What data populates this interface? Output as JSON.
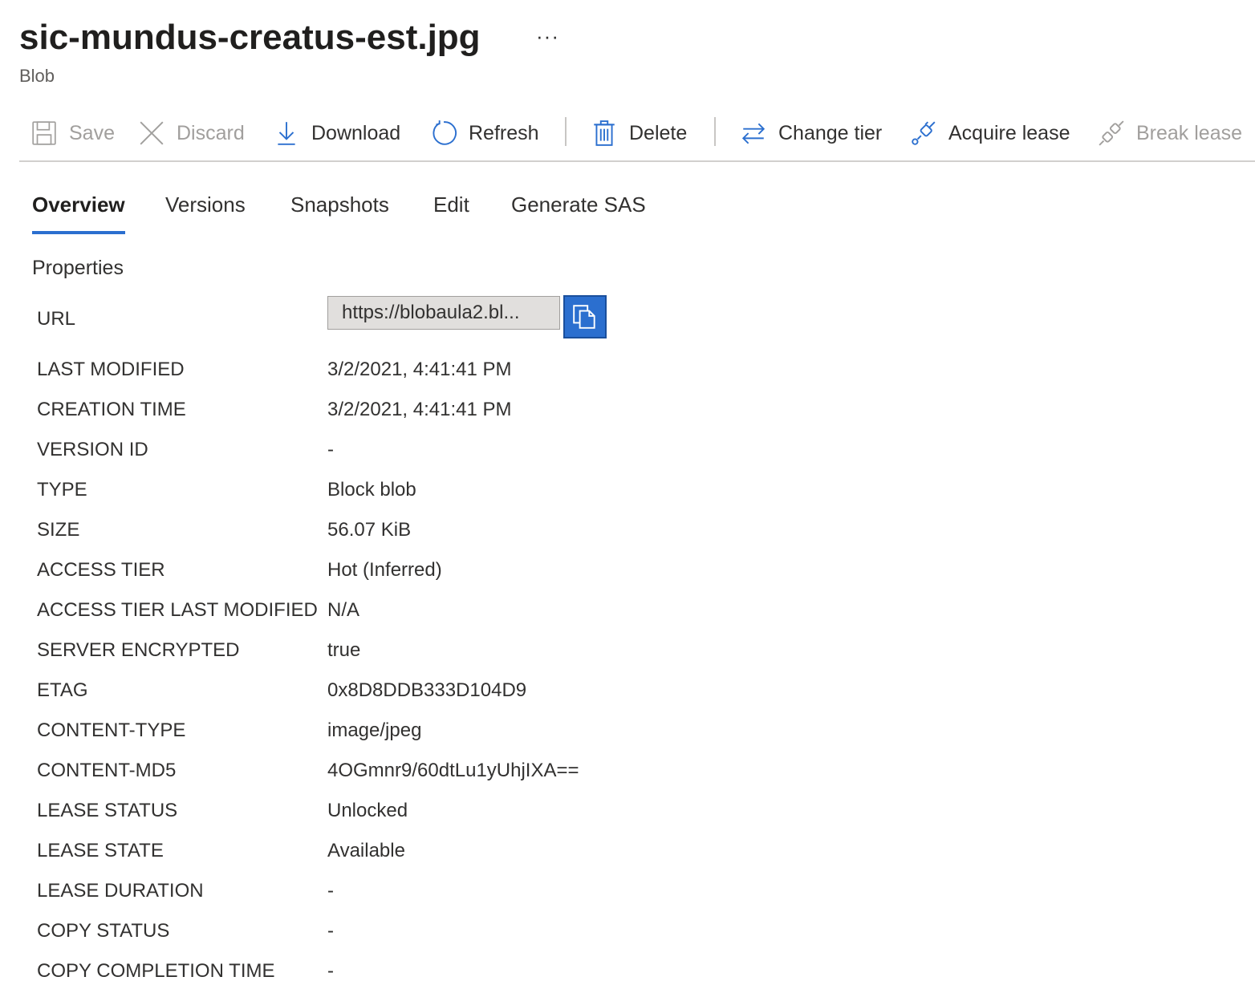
{
  "header": {
    "title": "sic-mundus-creatus-est.jpg",
    "subtitle": "Blob",
    "more_label": "···"
  },
  "toolbar": {
    "save": "Save",
    "discard": "Discard",
    "download": "Download",
    "refresh": "Refresh",
    "delete": "Delete",
    "change_tier": "Change tier",
    "acquire_lease": "Acquire lease",
    "break_lease": "Break lease"
  },
  "tabs": {
    "overview": "Overview",
    "versions": "Versions",
    "snapshots": "Snapshots",
    "edit": "Edit",
    "generate_sas": "Generate SAS",
    "active": "Overview"
  },
  "properties": {
    "heading": "Properties",
    "url_label": "URL",
    "url_value": "https://blobaula2.bl...",
    "rows": [
      {
        "label": "LAST MODIFIED",
        "value": "3/2/2021, 4:41:41 PM"
      },
      {
        "label": "CREATION TIME",
        "value": "3/2/2021, 4:41:41 PM"
      },
      {
        "label": "VERSION ID",
        "value": "-"
      },
      {
        "label": "TYPE",
        "value": "Block blob"
      },
      {
        "label": "SIZE",
        "value": "56.07 KiB"
      },
      {
        "label": "ACCESS TIER",
        "value": "Hot (Inferred)"
      },
      {
        "label": "ACCESS TIER LAST MODIFIED",
        "value": "N/A"
      },
      {
        "label": "SERVER ENCRYPTED",
        "value": "true"
      },
      {
        "label": "ETAG",
        "value": "0x8D8DDB333D104D9"
      },
      {
        "label": "CONTENT-TYPE",
        "value": "image/jpeg"
      },
      {
        "label": "CONTENT-MD5",
        "value": "4OGmnr9/60dtLu1yUhjIXA=="
      },
      {
        "label": "LEASE STATUS",
        "value": "Unlocked"
      },
      {
        "label": "LEASE STATE",
        "value": "Available"
      },
      {
        "label": "LEASE DURATION",
        "value": "-"
      },
      {
        "label": "COPY STATUS",
        "value": "-"
      },
      {
        "label": "COPY COMPLETION TIME",
        "value": "-"
      }
    ]
  },
  "colors": {
    "accent": "#2b6fcf",
    "text": "#323130",
    "disabled": "#a19f9d"
  }
}
